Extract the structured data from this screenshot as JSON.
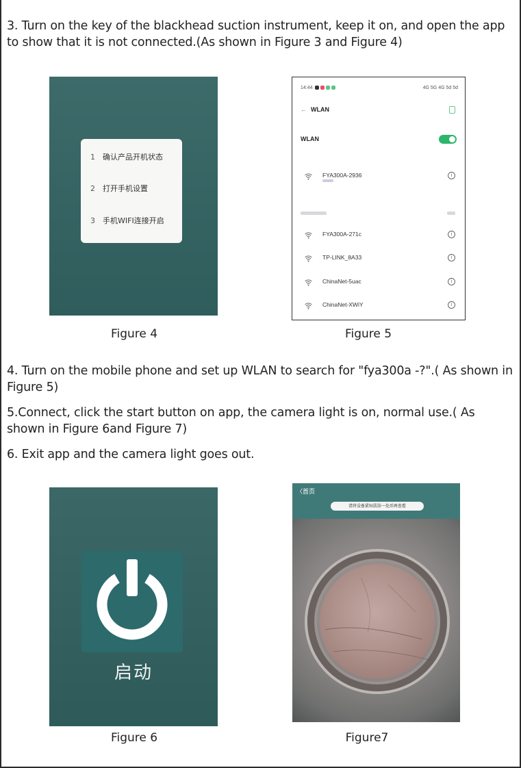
{
  "paragraphs": {
    "step3": "3. Turn on the key of the blackhead suction instrument, keep it on, and open the app to show that it is not connected.(As shown in Figure 3 and Figure 4)",
    "step4": "4. Turn on the mobile phone and set up WLAN to search for \"fya300a -?\".( As shown in Figure 5)",
    "step5": "5.Connect, click the start button on app, the camera light is on, normal use.( As shown in Figure 6and Figure 7)",
    "step6": "6. Exit app and the camera light goes out."
  },
  "captions": {
    "fig4": "Figure 4",
    "fig5": "Figure 5",
    "fig6": "Figure 6",
    "fig7": "Figure7"
  },
  "figure4": {
    "items": [
      {
        "num": "1",
        "label": "确认产品开机状态"
      },
      {
        "num": "2",
        "label": "打开手机设置"
      },
      {
        "num": "3",
        "label": "手机WIFI连接开启"
      }
    ],
    "colors": {
      "background": "#336261",
      "card": "#f7f7f5"
    }
  },
  "figure5": {
    "status_time": "14:44",
    "status_right": "4G 5G 4G 5d 5d",
    "header_title": "WLAN",
    "wlan_label": "WLAN",
    "toggle_on": true,
    "connected_network": {
      "name": "FYA300A-2936",
      "icon": "wifi-icon"
    },
    "networks": [
      {
        "name": "FYA300A-271c",
        "icon": "wifi-icon"
      },
      {
        "name": "TP-LINK_8A33",
        "icon": "wifi-icon"
      },
      {
        "name": "ChinaNet-5uac",
        "icon": "wifi-icon"
      },
      {
        "name": "ChinaNet-XWiY",
        "icon": "wifi-icon"
      }
    ],
    "colors": {
      "accent": "#2db66b"
    }
  },
  "figure6": {
    "label": "启动",
    "icon": "power-icon",
    "colors": {
      "background": "#336261",
      "tile": "#2c6a6c"
    }
  },
  "figure7": {
    "back_label": "〈首页",
    "banner_text": "请将设备紧贴肌肤一处后再查看",
    "colors": {
      "top": "#3f7a78"
    }
  }
}
